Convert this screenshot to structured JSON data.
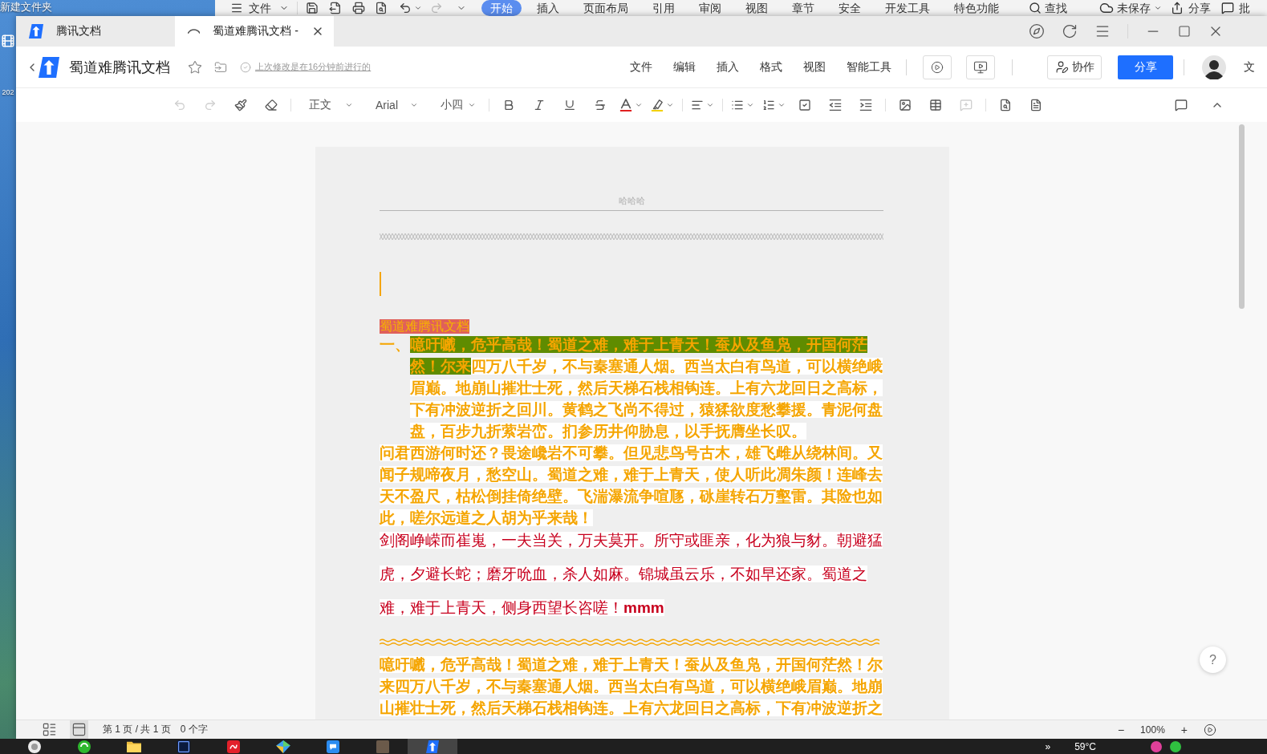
{
  "desktop": {
    "folder_label": "新建文件夹",
    "file_label": "202"
  },
  "wps_menubar": {
    "file_menu": "文件",
    "redo_disabled": true,
    "tabs": [
      {
        "label": "开始",
        "selected": true
      },
      {
        "label": "插入",
        "selected": false
      },
      {
        "label": "页面布局",
        "selected": false
      },
      {
        "label": "引用",
        "selected": false
      },
      {
        "label": "审阅",
        "selected": false
      },
      {
        "label": "视图",
        "selected": false
      },
      {
        "label": "章节",
        "selected": false
      },
      {
        "label": "安全",
        "selected": false
      },
      {
        "label": "开发工具",
        "selected": false
      },
      {
        "label": "特色功能",
        "selected": false
      }
    ],
    "search": "查找",
    "save_status": "未保存",
    "share": "分享",
    "comment": "批"
  },
  "browser_tabs": [
    {
      "label": "腾讯文档",
      "selected": false,
      "loading": false
    },
    {
      "label": "蜀道难腾讯文档 -",
      "selected": true,
      "loading": true
    }
  ],
  "header": {
    "title": "蜀道难腾讯文档",
    "last_edit": "上次修改是在16分钟前进行的",
    "menu": [
      "文件",
      "编辑",
      "插入",
      "格式",
      "视图",
      "智能工具"
    ],
    "collaborate": "协作",
    "share": "分享",
    "cut_label": "文"
  },
  "toolbar": {
    "undo_disabled": true,
    "redo_disabled": true,
    "style": "正文",
    "font": "Arial",
    "size": "小四",
    "comment_disabled": true
  },
  "document": {
    "header_text": "哈哈哈",
    "blocks": [
      {
        "kind": "chain_divider"
      },
      {
        "kind": "empty",
        "caret": true
      },
      {
        "kind": "title",
        "text": "蜀道难腾讯文档"
      },
      {
        "kind": "numbered",
        "marker": "一、",
        "color": "#f5a500",
        "segments": [
          {
            "text": "噫吁嚱，危乎高哉！蜀道之难，难于上青天！蚕从及鱼凫，开国何茫然！尔来",
            "highlighted": true
          },
          {
            "text": "四万八千岁，不与秦塞通人烟。西当太白有鸟道，可以横绝峨眉巅。地崩山摧壮士死，然后天梯石栈相钩连。上有六龙回日之高标，下有冲波逆折之回川。黄鹤之飞尚不得过，猿猱欲度愁攀援。青泥何盘盘，百步九折萦岩峦。扪参历井仰胁息，以手抚膺坐长叹。",
            "highlighted": false
          }
        ]
      },
      {
        "kind": "bold",
        "color": "#f5a500",
        "text": "问君西游何时还？畏途巉岩不可攀。但见悲鸟号古木，雄飞雌从绕林间。又闻子规啼夜月，愁空山。蜀道之难，难于上青天，使人听此凋朱颜！连峰去天不盈尺，枯松倒挂倚绝壁。飞湍瀑流争喧豗，砯崖转石万壑雷。其险也如此，嗟尔远道之人胡为乎来哉！"
      },
      {
        "kind": "spaced",
        "color": "#c8001e",
        "text": "剑阁峥嵘而崔嵬，一夫当关，万夫莫开。所守或匪亲，化为狼与豺。朝避猛虎，夕避长蛇；磨牙吮血，杀人如麻。锦城虽云乐，不如早还家。蜀道之难，难于上青天，侧身西望长咨嗟！**mmm**"
      },
      {
        "kind": "wavy_divider"
      },
      {
        "kind": "bold",
        "color": "#f5a500",
        "text": "噫吁嚱，危乎高哉！蜀道之难，难于上青天！蚕从及鱼凫，开国何茫然！尔来四万八千岁，不与秦塞通人烟。西当太白有鸟道，可以横绝峨眉巅。地崩山摧壮士死，然后天梯石栈相钩连。上有六龙回日之高标，下有冲波逆折之"
      }
    ]
  },
  "help_button": "?",
  "status_bar": {
    "view_modes": [
      {
        "selected": false
      },
      {
        "selected": true
      }
    ],
    "page": "第 1 页 / 共 1 页",
    "words": "0 个字",
    "zoom_out": "−",
    "zoom": "100%",
    "zoom_in": "+"
  },
  "taskbar": {
    "apps": [
      {
        "active": false
      },
      {
        "active": false
      },
      {
        "active": false
      },
      {
        "active": false
      },
      {
        "active": false
      },
      {
        "active": false
      },
      {
        "active": false
      },
      {
        "active": false
      },
      {
        "active": true
      }
    ],
    "overflow": "»",
    "temperature": "59°C"
  }
}
